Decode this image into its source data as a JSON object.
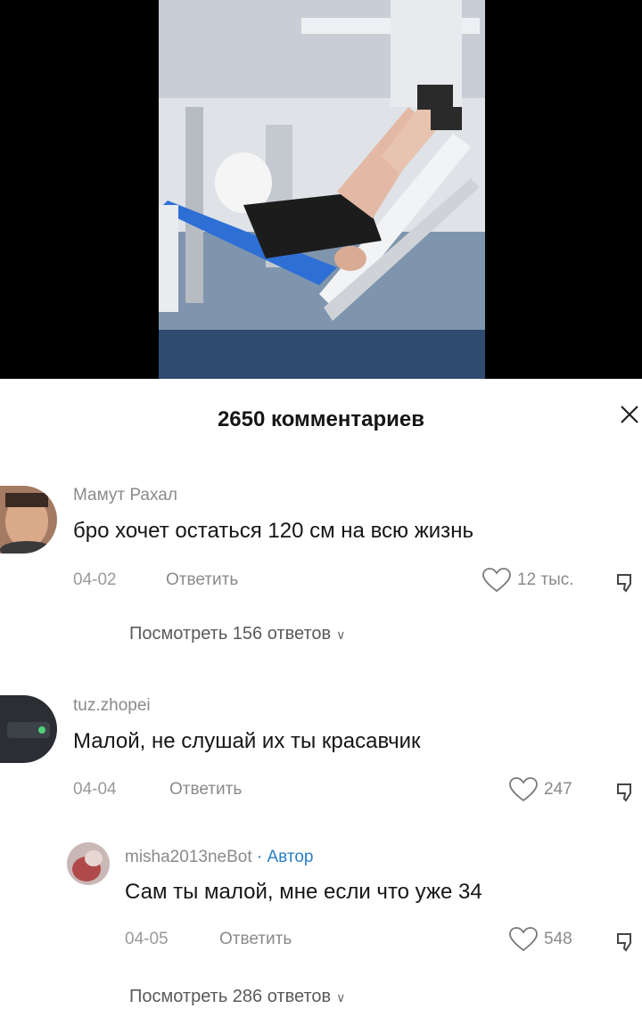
{
  "video": {
    "icon": "gym-leg-press-video"
  },
  "header": {
    "title": "2650 комментариев",
    "close_icon": "close-icon"
  },
  "comments": [
    {
      "username": "Мамут Рахал",
      "text": "бро хочет остаться 120 см на всю жизнь",
      "date": "04-02",
      "reply_label": "Ответить",
      "likes": "12 тыс.",
      "view_replies": "Посмотреть 156 ответов"
    },
    {
      "username": "tuz.zhopei",
      "text": "Малой, не слушай их ты красавчик",
      "date": "04-04",
      "reply_label": "Ответить",
      "likes": "247"
    },
    {
      "username": "misha2013neBot",
      "author_badge": "· Автор",
      "text": "Сам ты малой, мне если что уже 34",
      "date": "04-05",
      "reply_label": "Ответить",
      "likes": "548",
      "view_replies": "Посмотреть 286 ответов"
    }
  ],
  "colors": {
    "author": "#2a7fc7",
    "muted": "#8a8a8a",
    "text": "#161616"
  }
}
